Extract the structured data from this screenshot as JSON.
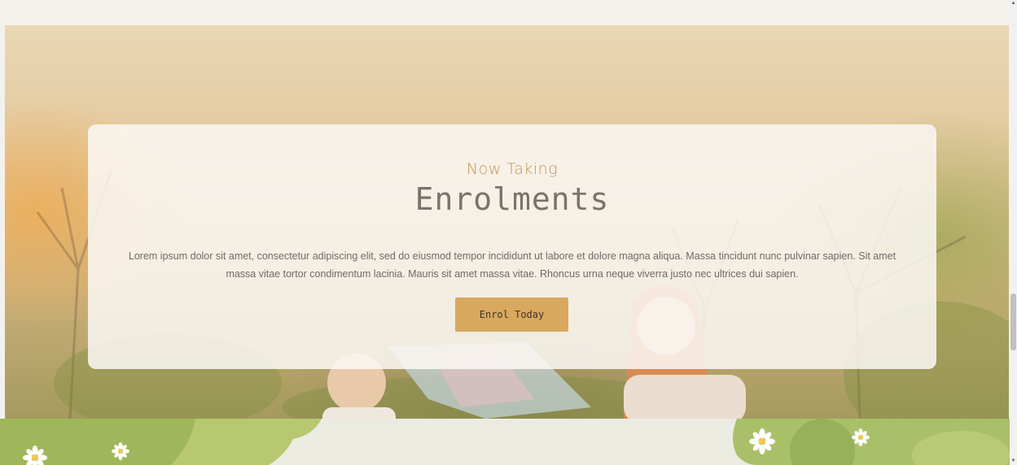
{
  "hero": {
    "eyebrow": "Now Taking",
    "title": "Enrolments",
    "description": "Lorem ipsum dolor sit amet, consectetur adipiscing elit, sed do eiusmod tempor incididunt ut labore et dolore magna aliqua. Massa tincidunt nunc pulvinar sapien. Sit amet massa vitae tortor condimentum lacinia. Mauris sit amet massa vitae. Rhoncus urna neque viverra justo nec ultrices dui sapien.",
    "cta_label": "Enrol Today"
  },
  "colors": {
    "accent": "#d9a85f",
    "eyebrow": "#c0955a",
    "title": "#7a736c",
    "green": "#a9c068"
  },
  "icons": {
    "scroll_up": "triangle-up",
    "scroll_down": "triangle-down",
    "decor": "daisy-flower"
  }
}
